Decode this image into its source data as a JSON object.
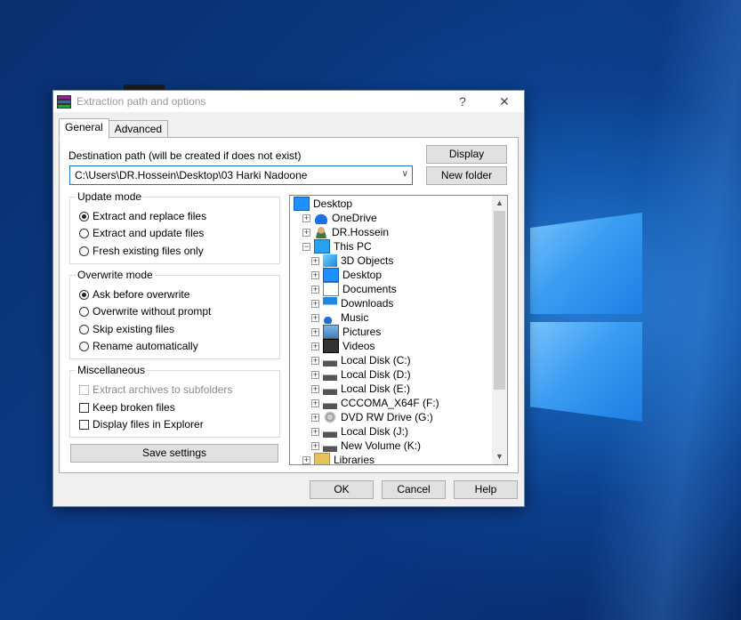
{
  "dialog": {
    "title": "Extraction path and options",
    "help_glyph": "?",
    "close_glyph": "✕"
  },
  "tabs": [
    {
      "label": "General"
    },
    {
      "label": "Advanced"
    }
  ],
  "destination": {
    "label": "Destination path (will be created if does not exist)",
    "value": "C:\\Users\\DR.Hossein\\Desktop\\03 Harki Nadoone"
  },
  "buttons": {
    "display": "Display",
    "new_folder": "New folder",
    "save_settings": "Save settings",
    "ok": "OK",
    "cancel": "Cancel",
    "help": "Help"
  },
  "update_mode": {
    "title": "Update mode",
    "options": [
      "Extract and replace files",
      "Extract and update files",
      "Fresh existing files only"
    ],
    "selected": 0
  },
  "overwrite_mode": {
    "title": "Overwrite mode",
    "options": [
      "Ask before overwrite",
      "Overwrite without prompt",
      "Skip existing files",
      "Rename automatically"
    ],
    "selected": 0
  },
  "misc": {
    "title": "Miscellaneous",
    "options": [
      {
        "label": "Extract archives to subfolders",
        "checked": false,
        "disabled": true
      },
      {
        "label": "Keep broken files",
        "checked": false,
        "disabled": false
      },
      {
        "label": "Display files in Explorer",
        "checked": false,
        "disabled": false
      }
    ]
  },
  "tree": [
    {
      "label": "Desktop",
      "icon": "desktop-icon"
    },
    {
      "label": "OneDrive",
      "icon": "onedrive-icon"
    },
    {
      "label": "DR.Hossein",
      "icon": "user-icon"
    },
    {
      "label": "This PC",
      "icon": "pc-icon"
    },
    {
      "label": "3D Objects",
      "icon": "3d-objects-icon"
    },
    {
      "label": "Desktop",
      "icon": "desktop-icon"
    },
    {
      "label": "Documents",
      "icon": "documents-icon"
    },
    {
      "label": "Downloads",
      "icon": "downloads-icon"
    },
    {
      "label": "Music",
      "icon": "music-icon"
    },
    {
      "label": "Pictures",
      "icon": "pictures-icon"
    },
    {
      "label": "Videos",
      "icon": "videos-icon"
    },
    {
      "label": "Local Disk (C:)",
      "icon": "drive-icon"
    },
    {
      "label": "Local Disk (D:)",
      "icon": "drive-icon"
    },
    {
      "label": "Local Disk (E:)",
      "icon": "drive-icon"
    },
    {
      "label": "CCCOMA_X64F (F:)",
      "icon": "drive-icon"
    },
    {
      "label": "DVD RW Drive (G:)",
      "icon": "dvd-icon"
    },
    {
      "label": "Local Disk (J:)",
      "icon": "drive-icon"
    },
    {
      "label": "New Volume (K:)",
      "icon": "drive-icon"
    },
    {
      "label": "Libraries",
      "icon": "libraries-icon"
    }
  ]
}
